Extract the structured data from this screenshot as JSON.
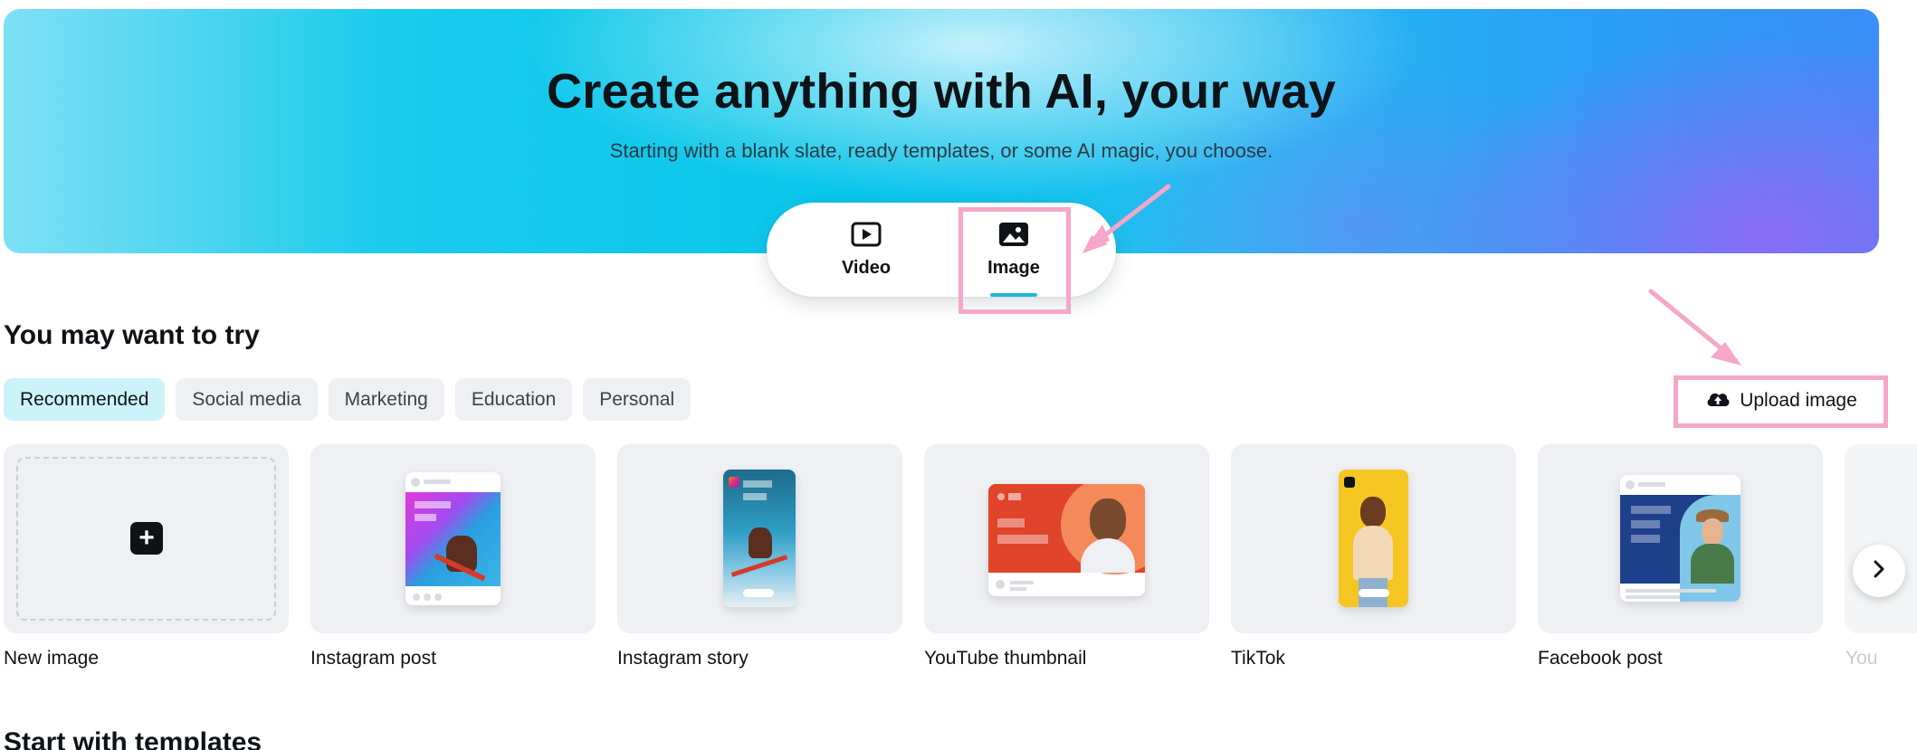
{
  "hero": {
    "title": "Create anything with AI, your way",
    "subtitle": "Starting with a blank slate, ready templates, or some AI magic, you choose."
  },
  "tabs": [
    {
      "label": "Video",
      "icon": "video-play-icon",
      "selected": false
    },
    {
      "label": "Image",
      "icon": "image-icon",
      "selected": true
    }
  ],
  "section": {
    "title": "You may want to try",
    "next_title": "Start with templates"
  },
  "chips": [
    {
      "label": "Recommended",
      "active": true
    },
    {
      "label": "Social media",
      "active": false
    },
    {
      "label": "Marketing",
      "active": false
    },
    {
      "label": "Education",
      "active": false
    },
    {
      "label": "Personal",
      "active": false
    }
  ],
  "upload": {
    "label": "Upload image",
    "icon": "cloud-upload-icon"
  },
  "cards": [
    {
      "label": "New image"
    },
    {
      "label": "Instagram post"
    },
    {
      "label": "Instagram story"
    },
    {
      "label": "YouTube thumbnail"
    },
    {
      "label": "TikTok"
    },
    {
      "label": "Facebook post"
    },
    {
      "label": "You"
    }
  ],
  "colors": {
    "accent": "#1fb8dc",
    "chip_active_bg": "#cdf3fa",
    "annotation": "#f6a6c8"
  }
}
